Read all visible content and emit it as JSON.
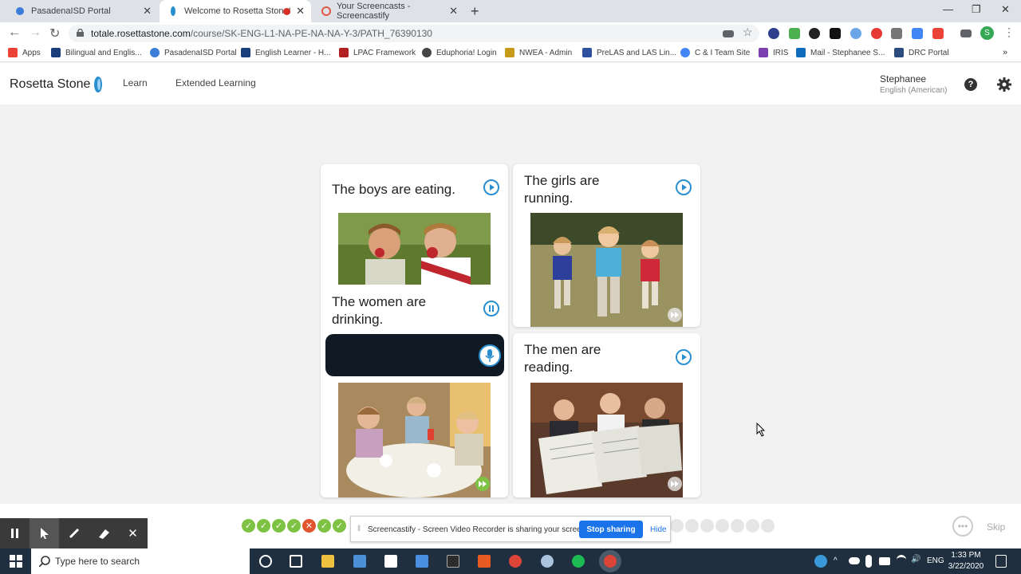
{
  "browser": {
    "tabs": [
      {
        "title": "PasadenaISD Portal",
        "active": false
      },
      {
        "title": "Welcome to Rosetta Stone!",
        "active": true
      },
      {
        "title": "Your Screencasts - Screencastify",
        "active": false
      }
    ],
    "url_host": "totale.rosettastone.com",
    "url_path": "/course/SK-ENG-L1-NA-PE-NA-NA-Y-3/PATH_76390130",
    "bookmarks": [
      "Apps",
      "Bilingual and Englis...",
      "PasadenaISD Portal",
      "English Learner - H...",
      "LPAC Framework",
      "Eduphoria! Login",
      "NWEA - Admin",
      "PreLAS and LAS Lin...",
      "C & I Team Site",
      "IRIS",
      "Mail - Stephanee S...",
      "DRC Portal"
    ],
    "profile_initial": "S"
  },
  "header": {
    "logo": "Rosetta Stone",
    "nav": {
      "learn": "Learn",
      "extended": "Extended Learning"
    },
    "user_name": "Stephanee",
    "user_lang": "English (American)"
  },
  "cards": [
    {
      "text": "The boys are eating.",
      "state": "play"
    },
    {
      "text": "The girls are running.",
      "state": "play"
    },
    {
      "text": "The women are drinking.",
      "state": "pause"
    },
    {
      "text": "The men are reading.",
      "state": "play"
    }
  ],
  "progress": {
    "results": [
      "correct",
      "correct",
      "correct",
      "correct",
      "wrong",
      "correct",
      "correct",
      "pending",
      "pending",
      "pending",
      "pending",
      "pending",
      "pending",
      "pending"
    ],
    "skip_label": "Skip"
  },
  "screencastify": {
    "message": "Screencastify - Screen Video Recorder is sharing your screen.",
    "stop_label": "Stop sharing",
    "hide_label": "Hide"
  },
  "taskbar": {
    "search_placeholder": "Type here to search",
    "lang": "ENG",
    "time": "1:33 PM",
    "date": "3/22/2020"
  },
  "colors": {
    "accent": "#2a8fd0",
    "correct": "#7dc242",
    "wrong": "#e2552f",
    "pending": "#e6e6e6"
  }
}
